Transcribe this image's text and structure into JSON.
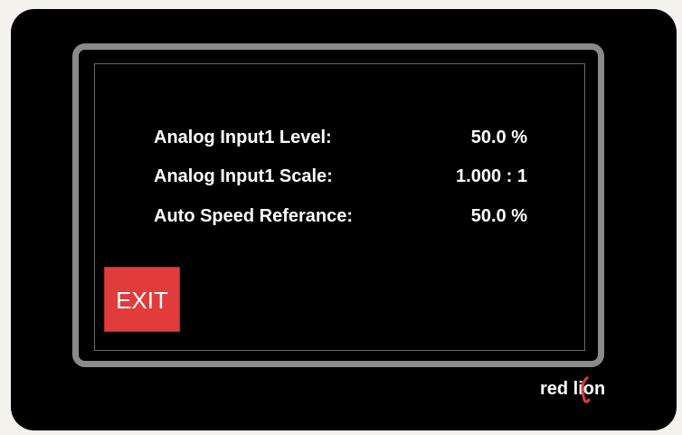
{
  "screen": {
    "rows": [
      {
        "label": "Analog Input1 Level:",
        "value": "50.0 %"
      },
      {
        "label": "Analog Input1 Scale:",
        "value": "1.000 : 1"
      },
      {
        "label": "Auto Speed Referance:",
        "value": "50.0 %"
      }
    ],
    "exit_label": "EXIT"
  },
  "brand": {
    "logo_text": "red lion",
    "accent_color": "#e13b3b"
  },
  "colors": {
    "device": "#000000",
    "bezel": "#8a8a8a",
    "text": "#ffffff",
    "exit_button": "#e13b3b"
  }
}
